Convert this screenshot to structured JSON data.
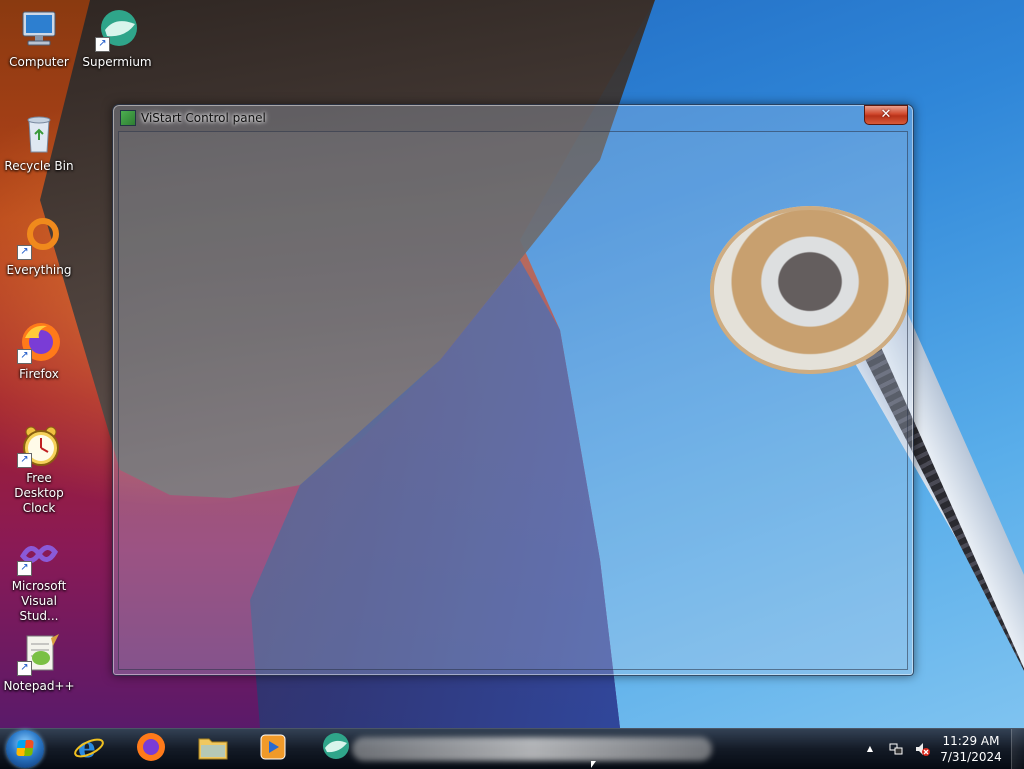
{
  "desktop": {
    "icons": [
      {
        "label": "Computer",
        "icon": "computer-icon",
        "shortcut": false
      },
      {
        "label": "Supermium",
        "icon": "supermium-icon",
        "shortcut": true
      },
      {
        "label": "Recycle Bin",
        "icon": "recycle-bin-icon",
        "shortcut": false
      },
      {
        "label": "Everything",
        "icon": "everything-icon",
        "shortcut": true
      },
      {
        "label": "Firefox",
        "icon": "firefox-icon",
        "shortcut": true
      },
      {
        "label": "Free Desktop Clock",
        "icon": "alarm-clock-icon",
        "shortcut": true
      },
      {
        "label": "Microsoft Visual Stud...",
        "icon": "visual-studio-icon",
        "shortcut": true
      },
      {
        "label": "Notepad++",
        "icon": "notepadpp-icon",
        "shortcut": true
      }
    ]
  },
  "window": {
    "title": "ViStart Control panel",
    "close_glyph": "✕"
  },
  "taskbar": {
    "pinned": [
      {
        "name": "internet-explorer",
        "icon": "ie-icon"
      },
      {
        "name": "firefox",
        "icon": "firefox-icon"
      },
      {
        "name": "file-explorer",
        "icon": "folder-icon"
      },
      {
        "name": "media-player",
        "icon": "media-player-icon"
      },
      {
        "name": "supermium",
        "icon": "supermium-icon"
      }
    ],
    "tray": {
      "overflow_glyph": "▲",
      "time": "11:29 AM",
      "date": "7/31/2024"
    }
  },
  "colors": {
    "close_button": "#c8391f",
    "taskbar": "#0f1622"
  }
}
